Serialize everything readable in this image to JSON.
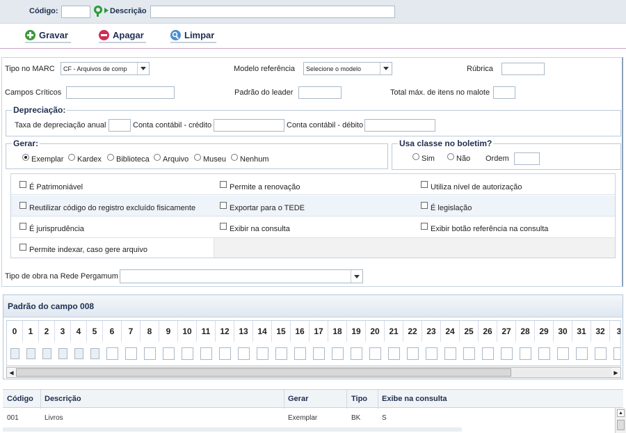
{
  "search": {
    "codigo_label": "Código:",
    "codigo_value": "",
    "descricao_label": "Descrição",
    "descricao_value": ""
  },
  "toolbar": {
    "gravar": "Gravar",
    "apagar": "Apagar",
    "limpar": "Limpar"
  },
  "form": {
    "tipo_marc_label": "Tipo no MARC",
    "tipo_marc_value": "CF - Arquivos de comp",
    "modelo_label": "Modelo referência",
    "modelo_value": "Selecione o modelo",
    "rubrica_label": "Rúbrica",
    "campos_criticos_label": "Campos Críticos",
    "padrao_leader_label": "Padrão do leader",
    "total_maximo_label": "Total máx. de itens no malote",
    "depreciacao": {
      "legend": "Depreciação:",
      "taxa_label": "Taxa de depreciação anual",
      "credito_label": "Conta contábil - crédito",
      "debito_label": "Conta contábil - débito"
    },
    "gerar": {
      "legend": "Gerar:",
      "options": [
        "Exemplar",
        "Kardex",
        "Biblioteca",
        "Arquivo",
        "Museu",
        "Nenhum"
      ],
      "selected": "Exemplar"
    },
    "boletim": {
      "legend": "Usa classe no boletim?",
      "sim": "Sim",
      "nao": "Não",
      "ordem_label": "Ordem"
    },
    "checks": {
      "patrimoniavel": "É Patrimoniável",
      "renovacao": "Permite a renovação",
      "nivel_autorizacao": "Utiliza nível de autorização",
      "reutilizar": "Reutilizar código do registro excluído fisicamente",
      "tede": "Exportar para o TEDE",
      "legislacao": "É legislação",
      "jurisprudencia": "É jurisprudência",
      "exibir_consulta": "Exibir na consulta",
      "botao_referencia": "Exibir botão referência na consulta",
      "indexar": "Permite indexar, caso gere arquivo"
    },
    "tipo_obra_label": "Tipo de obra na Rede Pergamum",
    "tipo_obra_value": ""
  },
  "campo008": {
    "title": "Padrão do campo 008",
    "positions": [
      "0",
      "1",
      "2",
      "3",
      "4",
      "5",
      "6",
      "7",
      "8",
      "9",
      "10",
      "11",
      "12",
      "13",
      "14",
      "15",
      "16",
      "17",
      "18",
      "19",
      "20",
      "21",
      "22",
      "23",
      "24",
      "25",
      "26",
      "27",
      "28",
      "29",
      "30",
      "31",
      "32",
      "3"
    ]
  },
  "table": {
    "headers": [
      "Código",
      "Descrição",
      "Gerar",
      "Tipo",
      "Exibe na consulta"
    ],
    "rows": [
      [
        "001",
        "Livros",
        "Exemplar",
        "BK",
        "S"
      ]
    ]
  },
  "colors": {
    "accent_navy": "#1d2e4f",
    "gravar_green": "#3a9a3a",
    "apagar_red": "#cc2e55",
    "limpar_blue": "#4a8ed0"
  },
  "icons": {
    "search_lookup": "search-icon",
    "gravar": "plus-icon",
    "apagar": "minus-icon",
    "limpar": "magnifier-icon"
  }
}
